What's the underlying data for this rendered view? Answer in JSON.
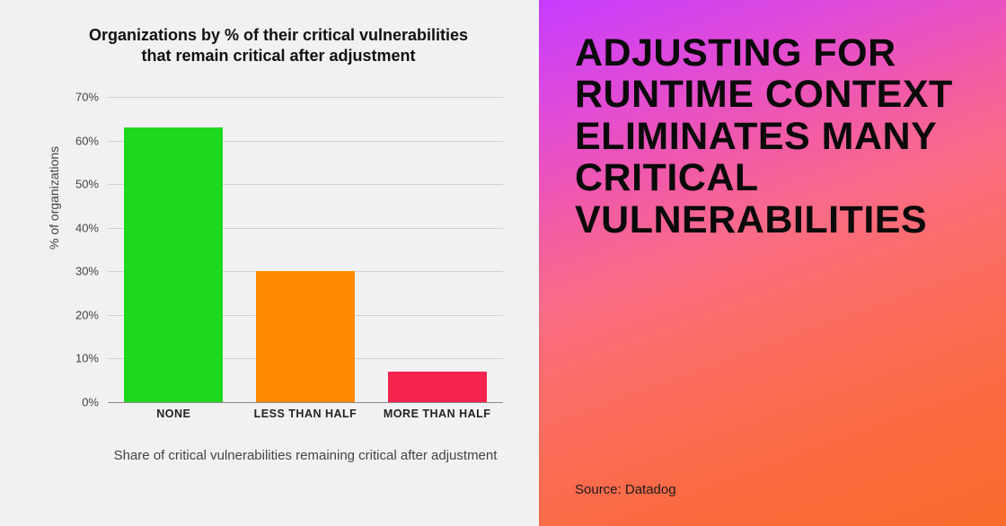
{
  "chart_data": {
    "type": "bar",
    "title": "Organizations by % of their critical vulnerabilities that remain critical after adjustment",
    "xlabel": "Share of critical vulnerabilities remaining critical after adjustment",
    "ylabel": "% of organizations",
    "ylim": [
      0,
      70
    ],
    "y_ticks": [
      0,
      10,
      20,
      30,
      40,
      50,
      60,
      70
    ],
    "y_tick_labels": [
      "0%",
      "10%",
      "20%",
      "30%",
      "40%",
      "50%",
      "60%",
      "70%"
    ],
    "categories": [
      "NONE",
      "LESS THAN HALF",
      "MORE THAN HALF"
    ],
    "values": [
      63,
      30,
      7
    ],
    "colors": [
      "#1ed81e",
      "#ff8a00",
      "#f6234f"
    ]
  },
  "headline": "ADJUSTING FOR RUNTIME CONTEXT ELIMINATES MANY CRITICAL VULNERABILITIES",
  "source": "Source: Datadog"
}
